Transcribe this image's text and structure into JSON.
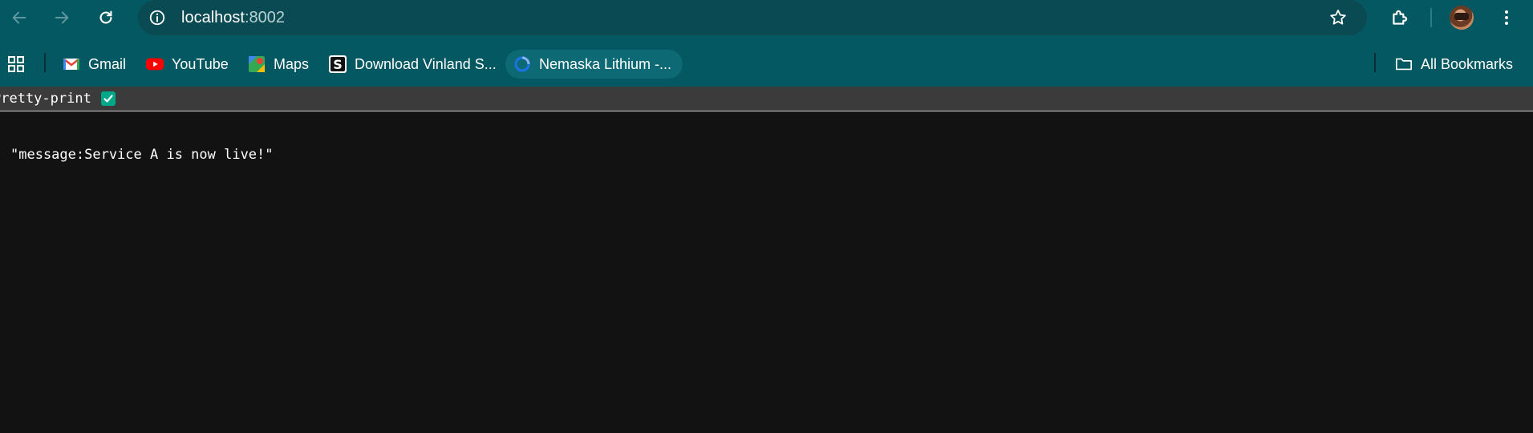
{
  "browser": {
    "url_host": "localhost",
    "url_port": ":8002",
    "icons": {
      "back": "arrow-left-icon",
      "forward": "arrow-right-icon",
      "reload": "reload-icon",
      "info": "info-icon",
      "star": "star-icon",
      "extensions": "puzzle-icon",
      "menu": "kebab-menu-icon"
    },
    "colors": {
      "toolbar": "#045861",
      "omnibox": "#0a4a52",
      "page_bg": "#121212",
      "checkbox": "#00a88a"
    }
  },
  "bookmarks": {
    "items": [
      {
        "label": "Gmail",
        "icon": "gmail-icon"
      },
      {
        "label": "YouTube",
        "icon": "youtube-icon"
      },
      {
        "label": "Maps",
        "icon": "maps-icon"
      },
      {
        "label": "Download Vinland S...",
        "icon": "s-logo-icon"
      },
      {
        "label": "Nemaska Lithium -...",
        "icon": "loading-ring-icon"
      }
    ],
    "all_bookmarks": "All Bookmarks"
  },
  "page": {
    "pretty_print_label": "Pretty-print",
    "pretty_print_checked": true,
    "json_text": "\"message:Service A is now live!\""
  }
}
